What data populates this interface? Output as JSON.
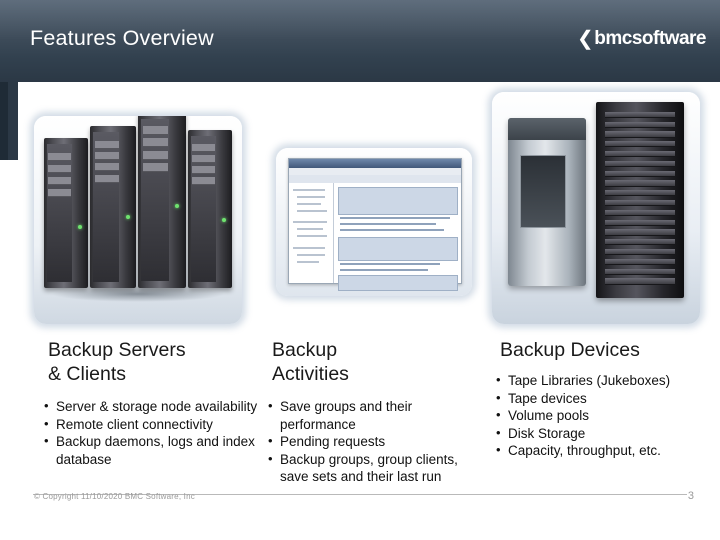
{
  "header": {
    "title": "Features Overview",
    "logo": {
      "swoosh": "❮",
      "bmc": "bmc",
      "software": "software"
    }
  },
  "images": [
    {
      "name": "backup-servers-photo",
      "alt": "Rack of tower servers"
    },
    {
      "name": "backup-activities-screenshot",
      "alt": "Backup management console screenshot"
    },
    {
      "name": "backup-devices-photo",
      "alt": "Tape library and disk storage rack"
    }
  ],
  "columns": [
    {
      "heading": "Backup Servers\n& Clients",
      "heading_lines": [
        "Backup Servers",
        "& Clients"
      ],
      "bullets": [
        "Server & storage node availability",
        "Remote client connectivity",
        "Backup daemons, logs and index database"
      ]
    },
    {
      "heading": "Backup\nActivities",
      "heading_lines": [
        "Backup",
        "Activities"
      ],
      "bullets": [
        "Save groups and their performance",
        "Pending requests",
        "Backup groups, group clients, save sets and their last run"
      ]
    },
    {
      "heading": "Backup Devices",
      "heading_lines": [
        "Backup Devices"
      ],
      "bullets": [
        "Tape Libraries (Jukeboxes)",
        "Tape devices",
        "Volume pools",
        "Disk Storage",
        "Capacity, throughput, etc."
      ]
    }
  ],
  "footer": {
    "copyright": "© Copyright 11/10/2020 BMC Software, Inc",
    "page_number": "3"
  },
  "colors": {
    "header_start": "#4d5d6e",
    "header_end": "#2b3845",
    "title_text": "#ffffff",
    "body_text": "#111111",
    "footer_text": "#9a9a9a"
  }
}
